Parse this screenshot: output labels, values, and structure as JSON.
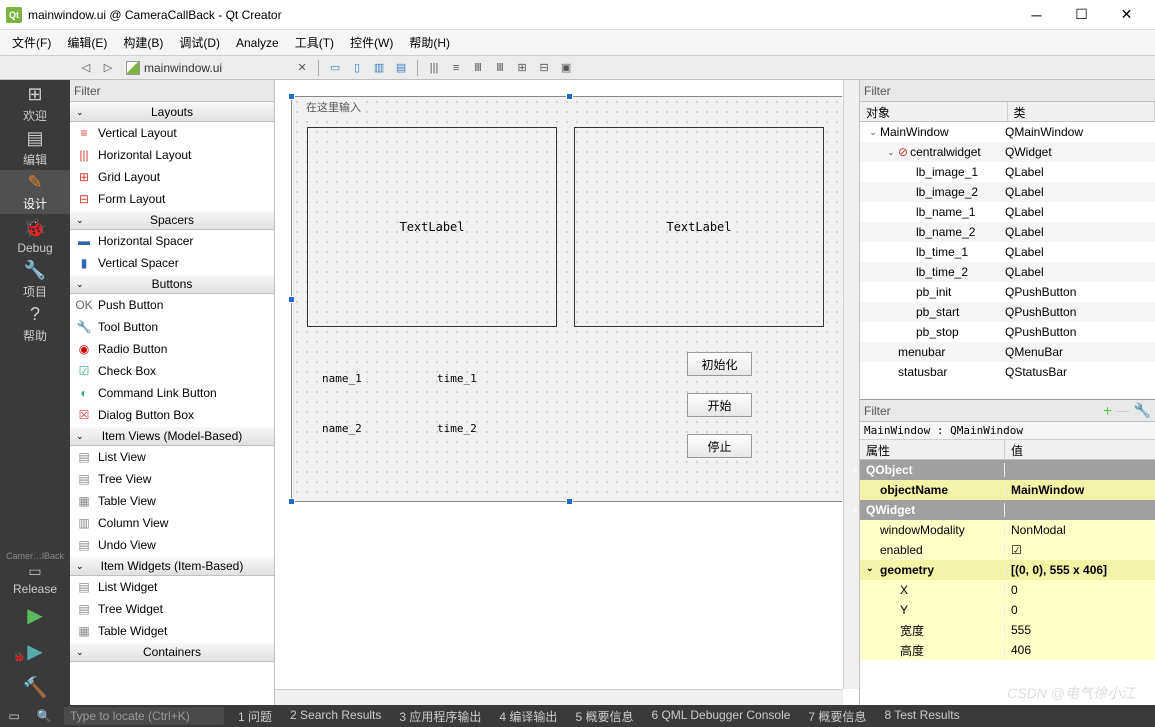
{
  "titlebar": {
    "title": "mainwindow.ui @ CameraCallBack - Qt Creator"
  },
  "menubar": [
    "文件(F)",
    "编辑(E)",
    "构建(B)",
    "调试(D)",
    "Analyze",
    "工具(T)",
    "控件(W)",
    "帮助(H)"
  ],
  "doc_path": "mainwindow.ui",
  "rail": [
    "欢迎",
    "编辑",
    "设计",
    "Debug",
    "项目",
    "帮助"
  ],
  "rail_kit": "Camer…lBack",
  "rail_config": "Release",
  "widget_filter": "Filter",
  "widget_groups": [
    {
      "name": "Layouts",
      "items": [
        {
          "label": "Vertical Layout",
          "icon": "≡",
          "color": "#d04030"
        },
        {
          "label": "Horizontal Layout",
          "icon": "|||",
          "color": "#d04030"
        },
        {
          "label": "Grid Layout",
          "icon": "⊞",
          "color": "#d04030"
        },
        {
          "label": "Form Layout",
          "icon": "⊟",
          "color": "#d04030"
        }
      ]
    },
    {
      "name": "Spacers",
      "items": [
        {
          "label": "Horizontal Spacer",
          "icon": "▬",
          "color": "#3066b0"
        },
        {
          "label": "Vertical Spacer",
          "icon": "▮",
          "color": "#3066b0"
        }
      ]
    },
    {
      "name": "Buttons",
      "items": [
        {
          "label": "Push Button",
          "icon": "OK",
          "color": "#666"
        },
        {
          "label": "Tool Button",
          "icon": "🔧",
          "color": "#666"
        },
        {
          "label": "Radio Button",
          "icon": "◉",
          "color": "#c00"
        },
        {
          "label": "Check Box",
          "icon": "☑",
          "color": "#3a8"
        },
        {
          "label": "Command Link Button",
          "icon": "◐",
          "color": "#3a8"
        },
        {
          "label": "Dialog Button Box",
          "icon": "☒",
          "color": "#c44"
        }
      ]
    },
    {
      "name": "Item Views (Model-Based)",
      "items": [
        {
          "label": "List View",
          "icon": "▤",
          "color": "#888"
        },
        {
          "label": "Tree View",
          "icon": "▤",
          "color": "#888"
        },
        {
          "label": "Table View",
          "icon": "▦",
          "color": "#888"
        },
        {
          "label": "Column View",
          "icon": "▥",
          "color": "#888"
        },
        {
          "label": "Undo View",
          "icon": "▤",
          "color": "#888"
        }
      ]
    },
    {
      "name": "Item Widgets (Item-Based)",
      "items": [
        {
          "label": "List Widget",
          "icon": "▤",
          "color": "#888"
        },
        {
          "label": "Tree Widget",
          "icon": "▤",
          "color": "#888"
        },
        {
          "label": "Table Widget",
          "icon": "▦",
          "color": "#888"
        }
      ]
    },
    {
      "name": "Containers",
      "items": []
    }
  ],
  "design": {
    "menu_hint": "在这里输入",
    "textlabel": "TextLabel",
    "name1": "name_1",
    "time1": "time_1",
    "name2": "name_2",
    "time2": "time_2",
    "btn_init": "初始化",
    "btn_start": "开始",
    "btn_stop": "停止"
  },
  "obj_filter": "Filter",
  "obj_headers": {
    "l": "对象",
    "r": "类"
  },
  "obj_tree": [
    {
      "indent": 0,
      "chev": "⌄",
      "name": "MainWindow",
      "cls": "QMainWindow"
    },
    {
      "indent": 1,
      "chev": "⌄",
      "name": "centralwidget",
      "cls": "QWidget",
      "red": true
    },
    {
      "indent": 2,
      "name": "lb_image_1",
      "cls": "QLabel"
    },
    {
      "indent": 2,
      "name": "lb_image_2",
      "cls": "QLabel"
    },
    {
      "indent": 2,
      "name": "lb_name_1",
      "cls": "QLabel"
    },
    {
      "indent": 2,
      "name": "lb_name_2",
      "cls": "QLabel"
    },
    {
      "indent": 2,
      "name": "lb_time_1",
      "cls": "QLabel"
    },
    {
      "indent": 2,
      "name": "lb_time_2",
      "cls": "QLabel"
    },
    {
      "indent": 2,
      "name": "pb_init",
      "cls": "QPushButton"
    },
    {
      "indent": 2,
      "name": "pb_start",
      "cls": "QPushButton"
    },
    {
      "indent": 2,
      "name": "pb_stop",
      "cls": "QPushButton"
    },
    {
      "indent": 1,
      "name": "menubar",
      "cls": "QMenuBar"
    },
    {
      "indent": 1,
      "name": "statusbar",
      "cls": "QStatusBar"
    }
  ],
  "prop_filter": "Filter",
  "prop_crumb": "MainWindow : QMainWindow",
  "prop_headers": {
    "l": "属性",
    "r": "值"
  },
  "props": [
    {
      "type": "group",
      "l": "QObject"
    },
    {
      "type": "yellowb",
      "l": "objectName",
      "r": "MainWindow"
    },
    {
      "type": "group",
      "l": "QWidget"
    },
    {
      "type": "yellow",
      "l": "windowModality",
      "r": "NonModal"
    },
    {
      "type": "yellow",
      "l": "enabled",
      "r": "☑"
    },
    {
      "type": "yellowb",
      "l": "geometry",
      "r": "[(0, 0), 555 x 406]",
      "chev": "⌄"
    },
    {
      "type": "yellow",
      "l": "X",
      "r": "0",
      "sub": true
    },
    {
      "type": "yellow",
      "l": "Y",
      "r": "0",
      "sub": true
    },
    {
      "type": "yellow",
      "l": "宽度",
      "r": "555",
      "sub": true
    },
    {
      "type": "yellow",
      "l": "高度",
      "r": "406",
      "sub": true
    }
  ],
  "statusbar": {
    "locate": "Type to locate (Ctrl+K)",
    "tabs": [
      "1  问题",
      "2  Search Results",
      "3  应用程序输出",
      "4  编译输出",
      "5  概要信息",
      "6  QML Debugger Console",
      "7  概要信息",
      "8  Test Results"
    ]
  },
  "watermark": "CSDN @电气徐小江"
}
